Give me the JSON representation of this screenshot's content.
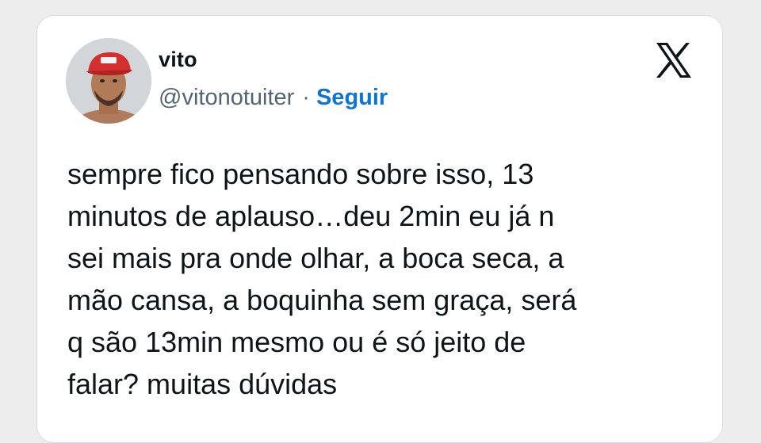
{
  "tweet": {
    "author": {
      "name": "vito",
      "handle": "@vitonotuiter",
      "separator": "·",
      "follow_label": "Seguir",
      "avatar_icon": "profile-photo"
    },
    "brand_icon": "x-logo-icon",
    "text": "sempre fico pensando sobre isso, 13\nminutos de aplauso…deu 2min eu já n\nsei mais pra onde olhar, a boca seca, a\nmão cansa, a boquinha sem graça, será\nq são 13min mesmo ou é só jeito de\nfalar? muitas dúvidas"
  },
  "colors": {
    "background": "#ededee",
    "card": "#ffffff",
    "text": "#0f1419",
    "muted": "#536471",
    "link": "#0f75d4"
  }
}
